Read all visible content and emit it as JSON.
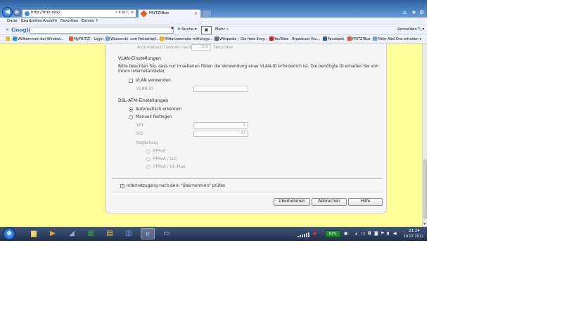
{
  "browser": {
    "address": "http://fritz.box/",
    "tab_title": "FRITZ!Box",
    "tab_close": "×",
    "back_icon": "arrow-left-icon",
    "home_icon": "⌂",
    "star_icon": "★",
    "gear_icon": "⚙"
  },
  "menubar": {
    "items": [
      "Datei",
      "Bearbeiten",
      "Ansicht",
      "Favoriten",
      "Extras",
      "?"
    ]
  },
  "google_toolbar": {
    "close": "×",
    "logo": "Google",
    "search_label": "Suche",
    "more_label": "Mehr »",
    "login_label": "Anmelden"
  },
  "favorites": [
    {
      "label": "Willkommen bei Window...",
      "color": "#3a8be0"
    },
    {
      "label": "MyFRITZ! - Login",
      "color": "#e05a28"
    },
    {
      "label": "Wasserski- und Freizeitanl...",
      "color": "#7aa0d0"
    },
    {
      "label": "Mitfahrzentrale  mitfahrge...",
      "color": "#f0b020"
    },
    {
      "label": "Wikipedia – Die freie Enzy...",
      "color": "#666666"
    },
    {
      "label": "YouTube - Broadcast You...",
      "color": "#d21f1f"
    },
    {
      "label": "Facebook",
      "color": "#3b5998"
    },
    {
      "label": "FRITZ!Box",
      "color": "#e05a28"
    },
    {
      "label": "Mehr Add-Ons erhalten",
      "color": "#7aa0d0"
    }
  ],
  "settings": {
    "auto_disconnect_label": "Automatisch trennen nach",
    "auto_disconnect_value": "300",
    "auto_disconnect_unit": "Sekunden",
    "vlan_heading": "VLAN-Einstellungen",
    "vlan_note_line1": "Bitte beachten Sie, dass nur in seltenen Fällen die Verwendung einer VLAN-ID erforderlich ist. Die benötigte ID erhalten Sie von",
    "vlan_note_line2": "Ihrem Internetanbieter.",
    "vlan_use_label": "VLAN verwenden",
    "vlan_use_checked": false,
    "vlan_id_label": "VLAN-ID",
    "vlan_id_value": "",
    "dsl_heading": "DSL-ATM-Einstellungen",
    "auto_detect_label": "Automatisch erkennen",
    "auto_detect_selected": true,
    "manual_label": "Manuell festlegen",
    "manual_selected": false,
    "vpi_label": "VPI",
    "vpi_value": "1",
    "vci_label": "VCI",
    "vci_value": "32",
    "encapsulation_label": "Kapselung",
    "encapsulation_options": [
      "PPPoE",
      "PPPoA / LLC",
      "PPPoA / VC-Mux"
    ],
    "check_internet_label": "Internetzugang nach dem \"Übernehmen\" prüfen",
    "check_internet_checked": true
  },
  "buttons": {
    "apply": "Übernehmen",
    "cancel": "Abbrechen",
    "help": "Hilfe"
  },
  "taskbar": {
    "battery": "81%",
    "time": "21:24",
    "date": "29.07.2012"
  },
  "colors": {
    "page_background": "#ffff99",
    "panel_background": "#f5f5f5",
    "titlebar": "#4f86c6",
    "taskbar": "#2a3d5e"
  }
}
